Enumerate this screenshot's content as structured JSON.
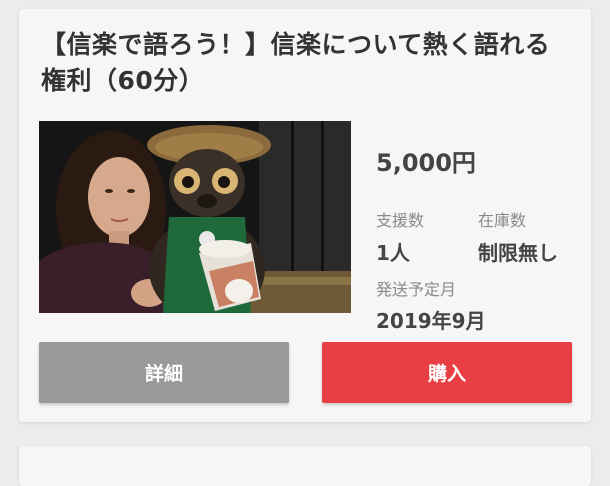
{
  "item": {
    "title": "【信楽で語ろう！】信楽について熱く語れる権利（60分）",
    "price": "5,000円",
    "supporters_label": "支援数",
    "supporters_value": "1人",
    "stock_label": "在庫数",
    "stock_value": "制限無し",
    "ship_label": "発送予定月",
    "ship_value": "2019年9月"
  },
  "actions": {
    "detail_label": "詳細",
    "buy_label": "購入"
  }
}
